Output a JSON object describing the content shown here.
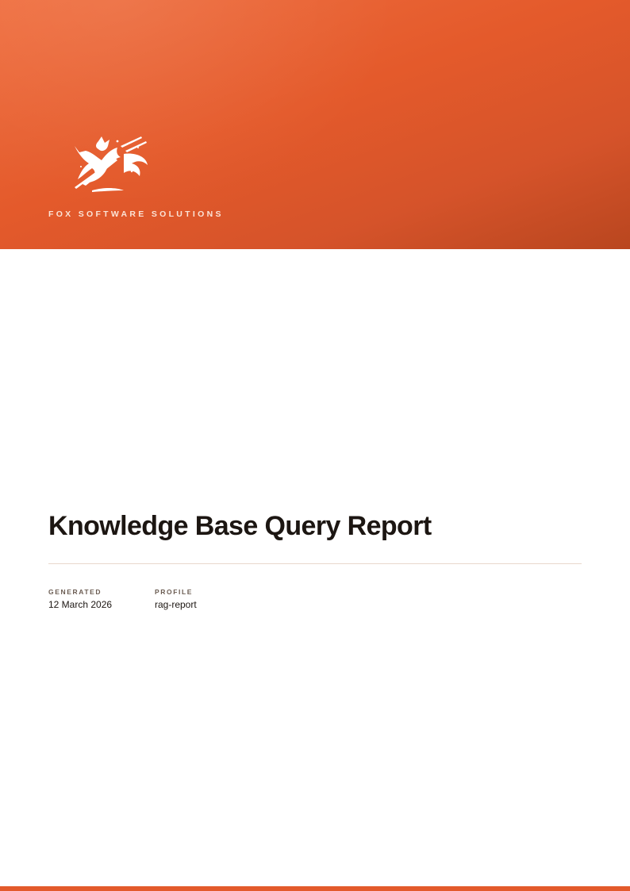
{
  "brand": {
    "name": "FOX SOFTWARE SOLUTIONS",
    "logo_icon": "fox-icon",
    "accent_color": "#e45a2b"
  },
  "document": {
    "title": "Knowledge Base Query Report"
  },
  "meta": {
    "generated": {
      "label": "GENERATED",
      "value": "12 March 2026"
    },
    "profile": {
      "label": "PROFILE",
      "value": "rag-report"
    }
  }
}
